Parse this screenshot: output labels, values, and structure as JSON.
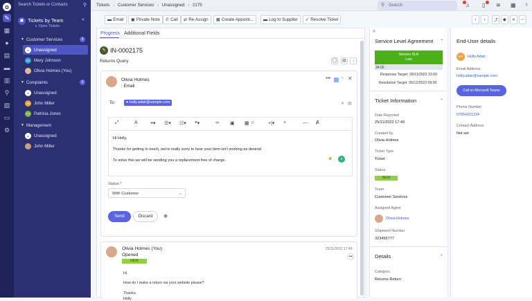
{
  "search_contacts": {
    "placeholder": "Search Tickets or Contacts"
  },
  "sidebar": {
    "title": "Tickets by Team",
    "subtitle": "Open Tickets",
    "groups": [
      {
        "name": "Customer Services",
        "count": "3"
      },
      {
        "name": "Complaints",
        "count": "3"
      },
      {
        "name": "Management",
        "count": ""
      }
    ],
    "items": [
      {
        "label": "Unassigned",
        "initials": ""
      },
      {
        "label": "Mary Johnson",
        "initials": "MJ"
      },
      {
        "label": "Olivia Holmes (You)",
        "initials": ""
      },
      {
        "label": "Unassigned",
        "initials": ""
      },
      {
        "label": "John Miller",
        "initials": "JM"
      },
      {
        "label": "Patricia Jones",
        "initials": "PJ"
      },
      {
        "label": "Unassigned",
        "initials": ""
      },
      {
        "label": "John Miller",
        "initials": ""
      }
    ]
  },
  "breadcrumb": {
    "items": [
      "Tickets",
      "Customer Services",
      "Unassigned",
      "2175"
    ]
  },
  "search": {
    "placeholder": "Search"
  },
  "toolbar": {
    "email": "Email",
    "private_note": "Private Note",
    "call": "Call",
    "reassign": "Re-Assign",
    "create_appointment": "Create Appoint...",
    "log_supplier": "Log to Supplier",
    "resolve": "Resolve Ticket"
  },
  "tabs": {
    "progress": "Progress",
    "additional_fields": "Additional Fields"
  },
  "ticket": {
    "id": "IN-0002175",
    "subject": "Returns Query"
  },
  "compose": {
    "author": "Olivia Holmes",
    "mode": "Email",
    "to_label": "To",
    "to_address": "holly.adair@sample.com",
    "body": [
      "Hi Holly,",
      "Thanks for getting in touch, we're really sorry to hear your item isn't working as desired",
      "To solve this we will be sending you a replacement free of charge."
    ],
    "status_label": "Status",
    "status_required": "*",
    "status_value": "With Customer",
    "send": "Send",
    "discard": "Discard"
  },
  "message": {
    "author": "Olivia Holmes (You)",
    "timestamp": "25/11/2022 17:49",
    "action": "Opened",
    "badge": "NEW",
    "lines": [
      "Hi,",
      "How do I make a return via your website please?",
      "Thanks,",
      "Holly"
    ]
  },
  "sla": {
    "title": "Service Level Agreement",
    "name": "Service SLA",
    "level": "Low",
    "timer": "34:00",
    "response_target": "Response Target: 26/11/2022 13:00",
    "resolution_target": "Resolution Target: 05/12/2022 09:00"
  },
  "ticket_info": {
    "title": "Ticket Information",
    "date_reported_label": "Date Reported",
    "date_reported": "25/11/2022 17:49",
    "created_by_label": "Created by",
    "created_by": "Olivia Holmes",
    "ticket_type_label": "Ticket Type",
    "ticket_type": "Ticket",
    "status_label": "Status",
    "status": "NEW",
    "team_label": "Team",
    "team": "Customer Services",
    "agent_label": "Assigned Agent",
    "agent": "Olivia Holmes",
    "shipment_label": "Shipment Number",
    "shipment": "323456777"
  },
  "details": {
    "title": "Details",
    "category_label": "Category",
    "category": "Returns-Return"
  },
  "end_user": {
    "title": "End-User details",
    "initials": "HA",
    "name": "Holly Adair",
    "email_label": "Email Address",
    "email": "holly.adair@sample.com",
    "call_button": "Call on Microsoft Teams",
    "phone_label": "Phone Number",
    "phone": "07654321234",
    "contact_label": "Contact Address",
    "contact": "Not set"
  },
  "colors": {
    "rail": "#1e2256",
    "sidebar": "#2b3073",
    "accent": "#4e56c6",
    "sla_green": "#4caf1a",
    "new_badge": "#8fd14f"
  }
}
